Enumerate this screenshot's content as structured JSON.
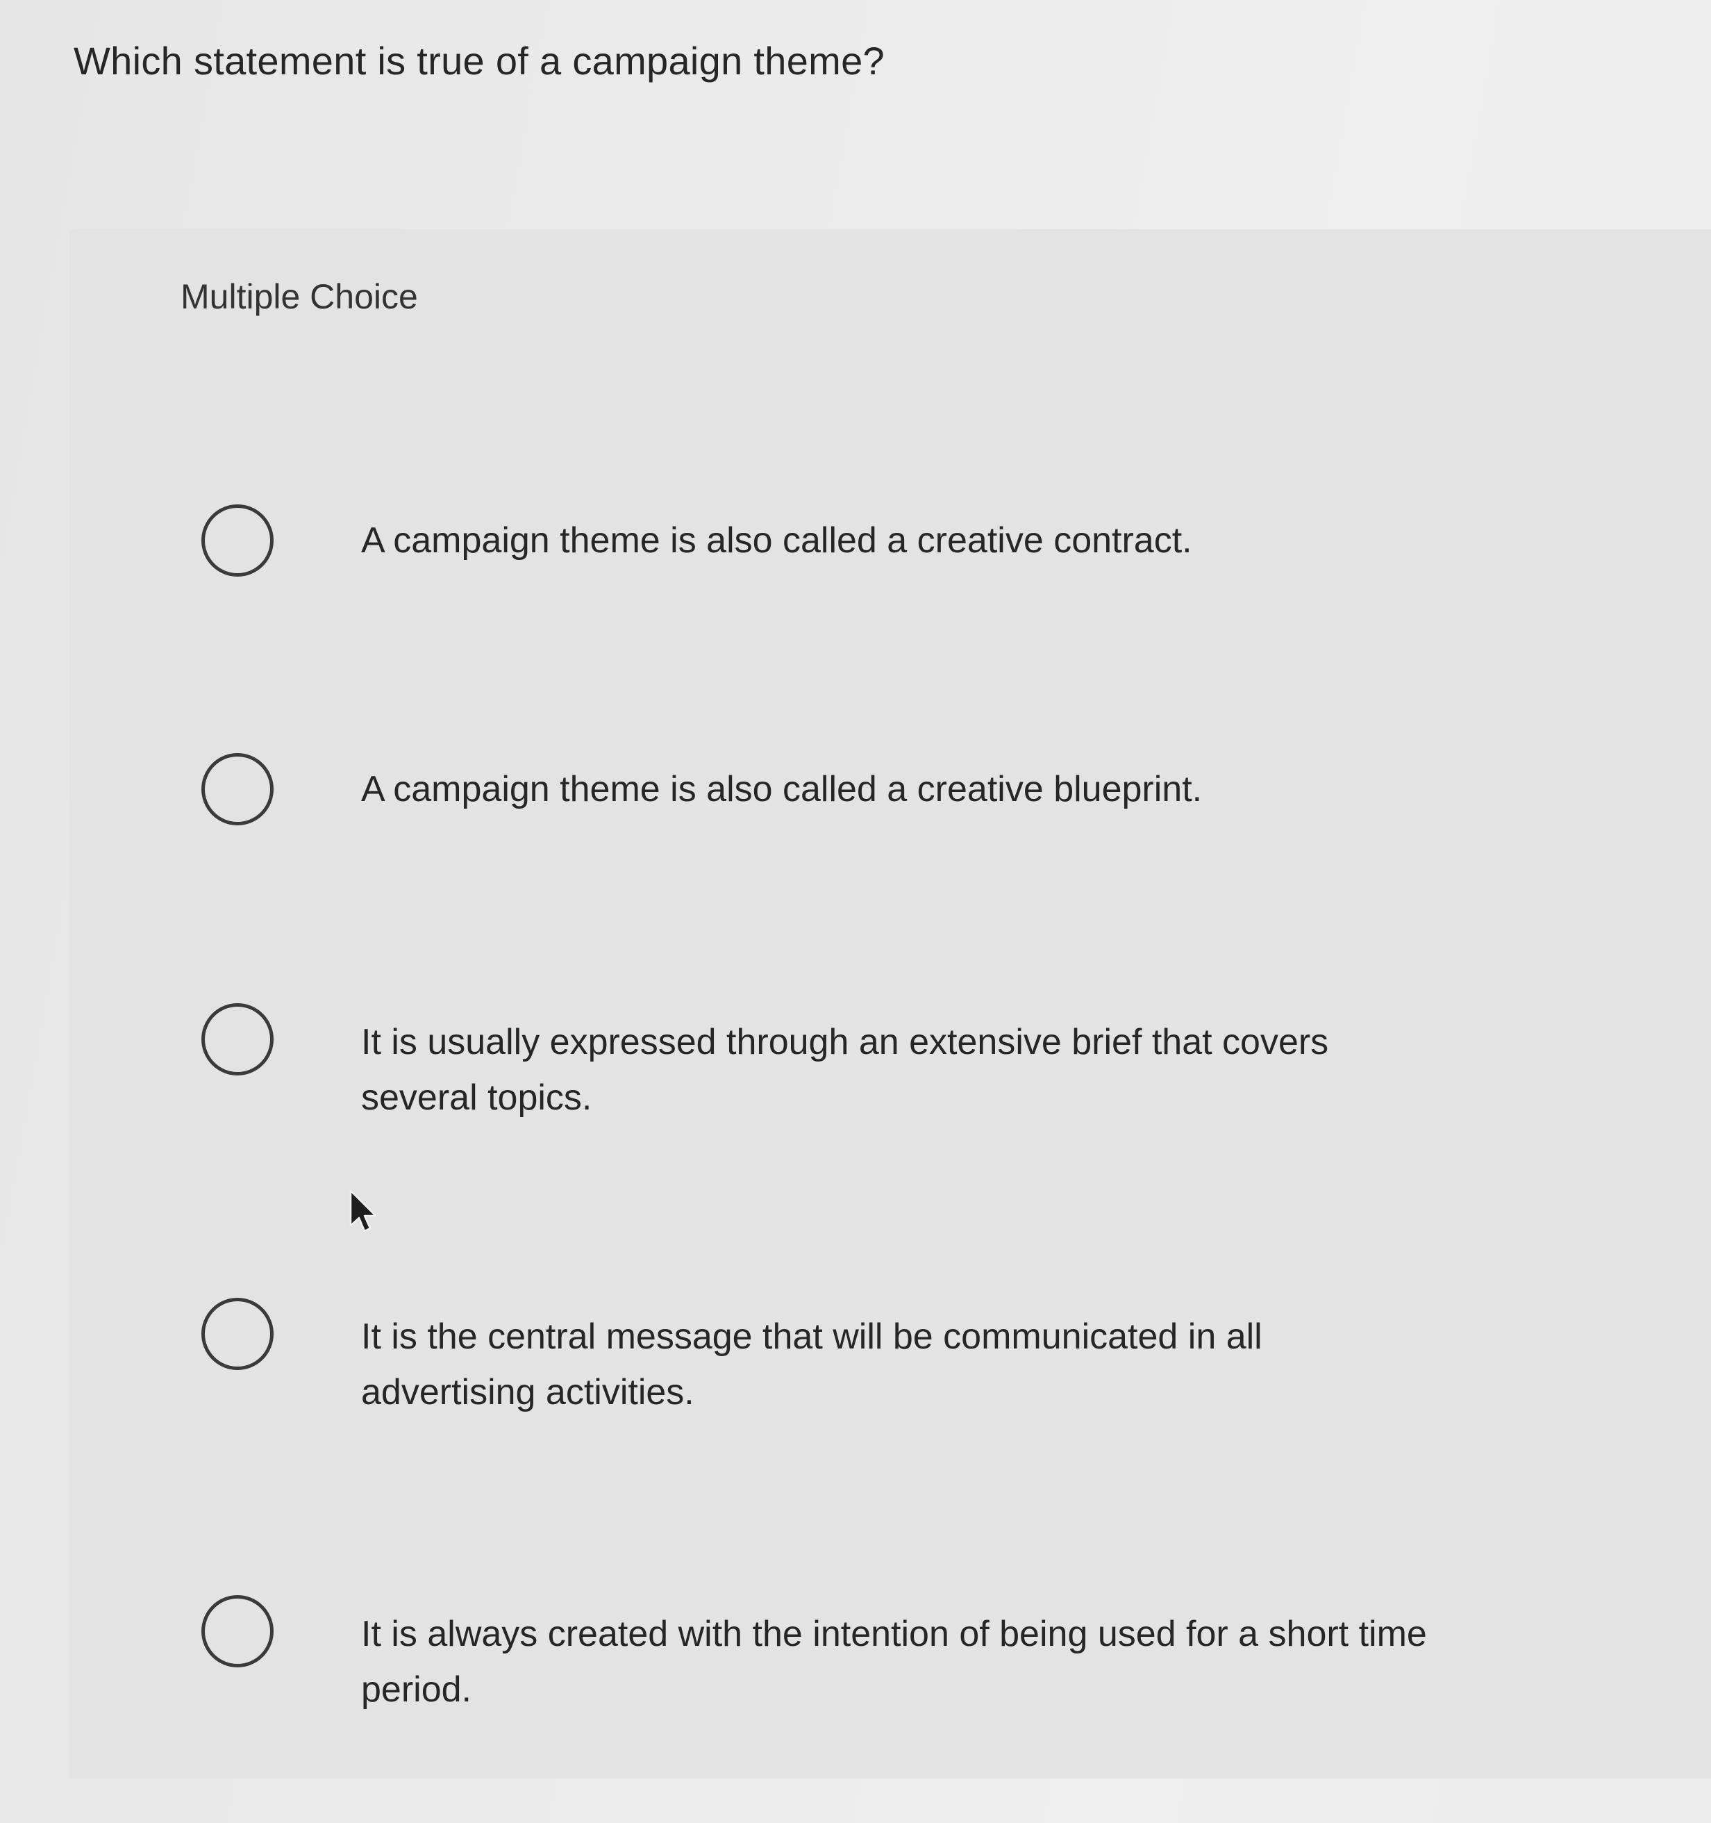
{
  "question": {
    "prompt": "Which statement is true of a campaign theme?",
    "type_label": "Multiple Choice"
  },
  "answers": [
    {
      "label": "A campaign theme is also called a creative contract.",
      "selected": false
    },
    {
      "label": "A campaign theme is also called a creative blueprint.",
      "selected": false
    },
    {
      "label": "It is usually expressed through an extensive brief that covers several topics.",
      "selected": false
    },
    {
      "label": "It is the central message that will be communicated in all advertising activities.",
      "selected": false
    },
    {
      "label": "It is always created with the intention of being used for a short time period.",
      "selected": false
    }
  ],
  "icons": {
    "radio": "radio-unchecked-icon",
    "cursor": "mouse-pointer-icon"
  }
}
